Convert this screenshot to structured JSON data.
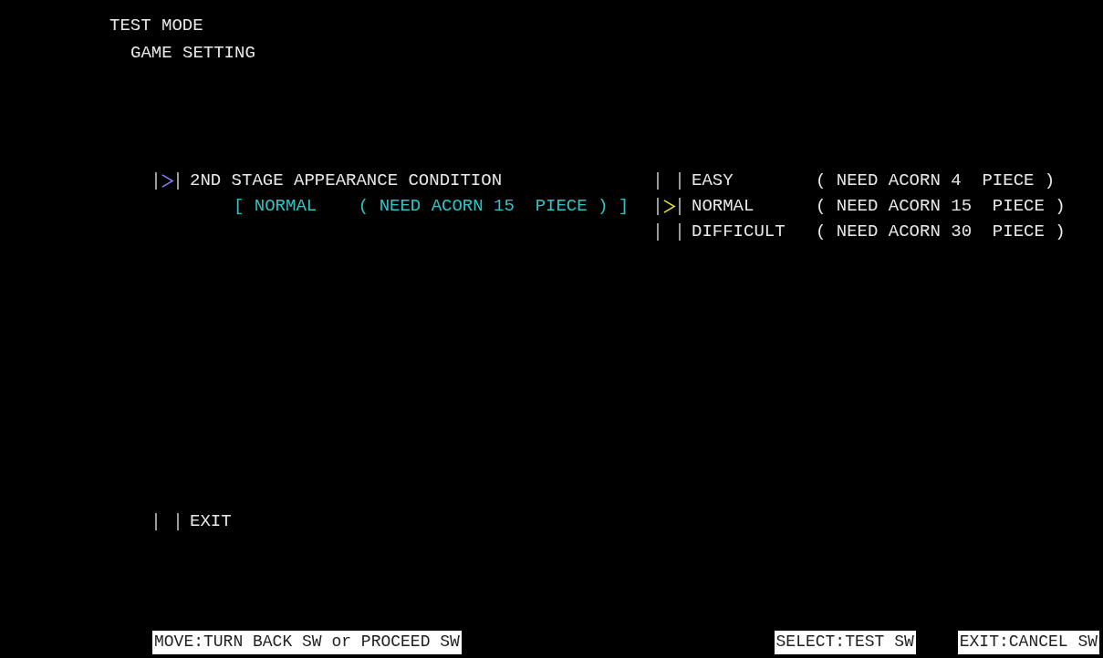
{
  "header": {
    "title": "TEST MODE",
    "subtitle": "GAME SETTING"
  },
  "menu": [
    {
      "kind": "setting",
      "label": "2ND STAGE APPEARANCE CONDITION",
      "selected": true,
      "current_value": "[ NORMAL    ( NEED ACORN 15  PIECE ) ]",
      "options": [
        {
          "label": "EASY",
          "requirement": "( NEED ACORN 4  PIECE )",
          "selected": false
        },
        {
          "label": "NORMAL",
          "requirement": "( NEED ACORN 15  PIECE )",
          "selected": true
        },
        {
          "label": "DIFFICULT",
          "requirement": "( NEED ACORN 30  PIECE )",
          "selected": false
        }
      ]
    },
    {
      "kind": "action",
      "label": "EXIT",
      "selected": false
    }
  ],
  "footer": [
    "MOVE:TURN BACK SW or PROCEED SW",
    "SELECT:TEST SW",
    "EXIT:CANCEL SW"
  ]
}
